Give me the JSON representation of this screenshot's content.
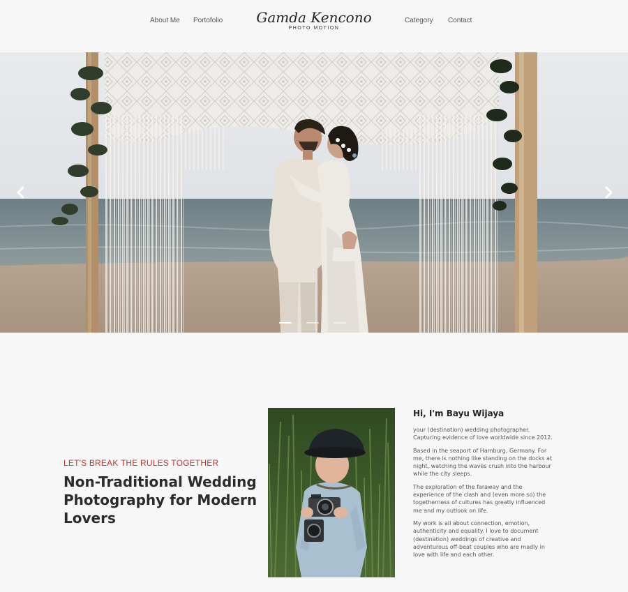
{
  "nav": {
    "links": [
      "About Me",
      "Portofolio",
      "Category",
      "Contact"
    ],
    "logo_script": "Gamda Kencono",
    "logo_sub": "PHOTO MOTION"
  },
  "hero": {
    "slides": 3,
    "active_slide": 1,
    "prev_icon": "chevron-left-icon",
    "next_icon": "chevron-right-icon"
  },
  "about": {
    "eyebrow": "LET'S BREAK THE RULES TOGETHER",
    "headline": "Non-Traditional Wedding Photography for Modern Lovers",
    "bio_title": "Hi, I'm Bayu Wijaya",
    "paragraphs": [
      "your (destination) wedding photographer. Capturing evidence of love worldwide since 2012.",
      "Based in the seaport of Hamburg, Germany. For me, there is nothing like standing on the docks at night, watching the waves crush into the harbour while the city sleeps.",
      "The exploration of the faraway and the experience of the clash and (even more so) the togetherness of cultures has greatly influenced me and my outlook on life.",
      "My work is all about connection, emotion, authenticity and equality. I love to document (destination) weddings of creative and adventurous off-beat couples who are madly in love with life and each other."
    ]
  },
  "colors": {
    "background": "#f7f7f7",
    "accent": "#c0392b",
    "text": "#2b2b2b"
  }
}
